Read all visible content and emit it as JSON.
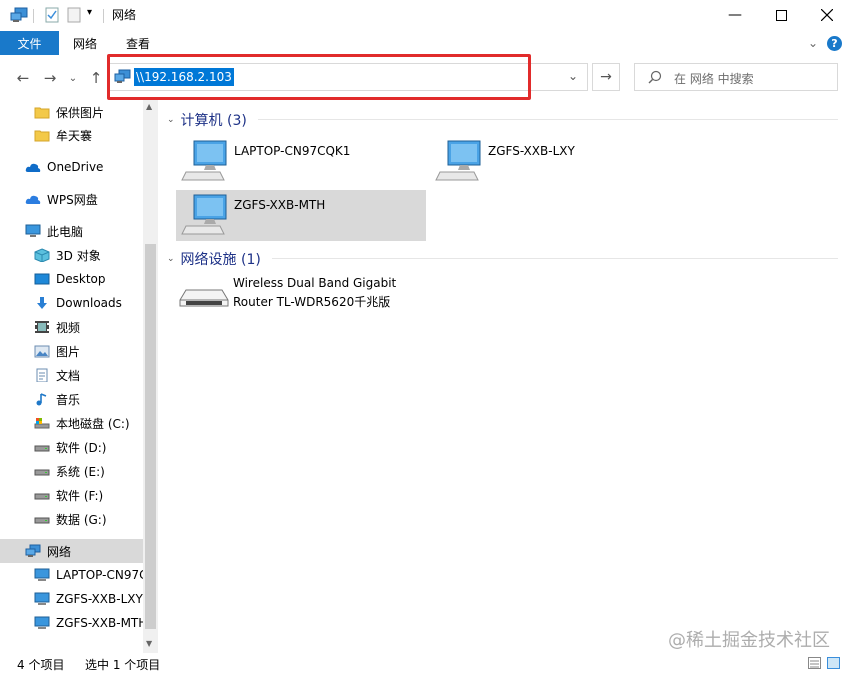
{
  "window": {
    "title": "网络"
  },
  "ribbon": {
    "tabs": [
      "文件",
      "网络",
      "查看"
    ]
  },
  "address": {
    "path": "\\\\192.168.2.103"
  },
  "search": {
    "placeholder": "在 网络 中搜索"
  },
  "sidebar": {
    "items": [
      {
        "label": "保供图片",
        "icon": "folder-icon"
      },
      {
        "label": "牟天褰",
        "icon": "folder-icon"
      },
      {
        "label": "OneDrive",
        "icon": "cloud-icon"
      },
      {
        "label": "WPS网盘",
        "icon": "cloud-icon"
      },
      {
        "label": "此电脑",
        "icon": "computer-icon"
      },
      {
        "label": "3D 对象",
        "icon": "cube-icon"
      },
      {
        "label": "Desktop",
        "icon": "desktop-icon"
      },
      {
        "label": "Downloads",
        "icon": "download-icon"
      },
      {
        "label": "视频",
        "icon": "video-icon"
      },
      {
        "label": "图片",
        "icon": "picture-icon"
      },
      {
        "label": "文档",
        "icon": "document-icon"
      },
      {
        "label": "音乐",
        "icon": "music-icon"
      },
      {
        "label": "本地磁盘 (C:)",
        "icon": "drive-icon"
      },
      {
        "label": "软件 (D:)",
        "icon": "drive-icon"
      },
      {
        "label": "系统 (E:)",
        "icon": "drive-icon"
      },
      {
        "label": "软件 (F:)",
        "icon": "drive-icon"
      },
      {
        "label": "数据 (G:)",
        "icon": "drive-icon"
      },
      {
        "label": "网络",
        "icon": "network-icon"
      },
      {
        "label": "LAPTOP-CN97C",
        "icon": "monitor-icon"
      },
      {
        "label": "ZGFS-XXB-LXY",
        "icon": "monitor-icon"
      },
      {
        "label": "ZGFS-XXB-MTH",
        "icon": "monitor-icon"
      }
    ]
  },
  "groups": {
    "computers": {
      "title": "计算机 (3)",
      "items": [
        "LAPTOP-CN97CQK1",
        "ZGFS-XXB-LXY",
        "ZGFS-XXB-MTH"
      ]
    },
    "devices": {
      "title": "网络设施 (1)",
      "items": [
        {
          "line1": "Wireless Dual Band Gigabit",
          "line2": "Router TL-WDR5620千兆版"
        }
      ]
    }
  },
  "status": {
    "count": "4 个项目",
    "selected": "选中 1 个项目"
  },
  "watermark": "@稀土掘金技术社区"
}
